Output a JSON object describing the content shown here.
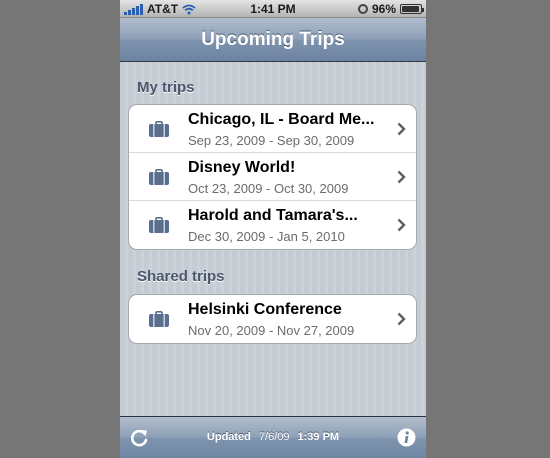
{
  "status_bar": {
    "carrier": "AT&T",
    "time": "1:41 PM",
    "battery": "96%",
    "battery_level": 0.96,
    "icons": [
      "signal-bars-icon",
      "wifi-icon",
      "alarm-icon",
      "battery-icon"
    ]
  },
  "nav": {
    "title": "Upcoming Trips"
  },
  "sections": [
    {
      "header": "My trips",
      "rows": [
        {
          "title": "Chicago, IL - Board Me...",
          "dates": "Sep 23, 2009 - Sep 30, 2009"
        },
        {
          "title": "Disney World!",
          "dates": "Oct 23, 2009 - Oct 30, 2009"
        },
        {
          "title": "Harold and Tamara's...",
          "dates": "Dec 30, 2009 - Jan 5, 2010"
        }
      ]
    },
    {
      "header": "Shared trips",
      "rows": [
        {
          "title": "Helsinki Conference",
          "dates": "Nov 20, 2009 - Nov 27, 2009"
        }
      ]
    }
  ],
  "toolbar": {
    "updated_label": "Updated",
    "updated_date": "7/6/09",
    "updated_time": "1:39 PM",
    "icons": [
      "refresh-icon",
      "info-icon"
    ]
  },
  "colors": {
    "navbar": "#6d84a2",
    "background": "#c5ccd4",
    "section_header": "#4c566c",
    "subtitle": "#6b6b6b",
    "suitcase": "#5a6f8e"
  }
}
